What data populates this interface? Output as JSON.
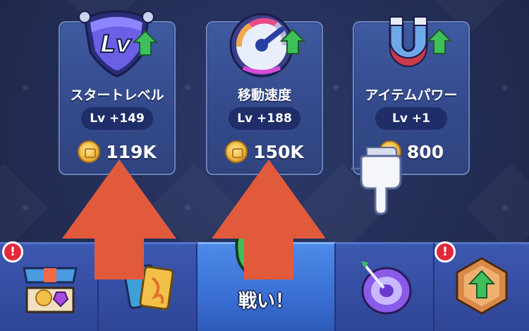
{
  "upgrades": [
    {
      "name": "スタートレベル",
      "level": "Lv +149",
      "cost": "119K",
      "icon": "lv-shield-icon"
    },
    {
      "name": "移動速度",
      "level": "Lv +188",
      "cost": "150K",
      "icon": "speedometer-icon"
    },
    {
      "name": "アイテムパワー",
      "level": "Lv +1",
      "cost": "800",
      "icon": "magnet-icon"
    }
  ],
  "nav": {
    "tabs": [
      {
        "id": "shop",
        "icon": "shop-icon",
        "alert": "!"
      },
      {
        "id": "cards",
        "icon": "cards-icon"
      },
      {
        "id": "battle",
        "icon": "battle-icon",
        "label": "戦い！"
      },
      {
        "id": "target",
        "icon": "target-icon"
      },
      {
        "id": "upgrade",
        "icon": "upgrade-badge-icon",
        "alert": "!"
      }
    ]
  },
  "colors": {
    "background": "#25315a",
    "card": "#3a5196",
    "level_pill": "#1f2d68",
    "tutorial_arrow": "#e25a3c",
    "upgrade_arrow": "#3fbf5a",
    "alert": "#e0293b"
  }
}
